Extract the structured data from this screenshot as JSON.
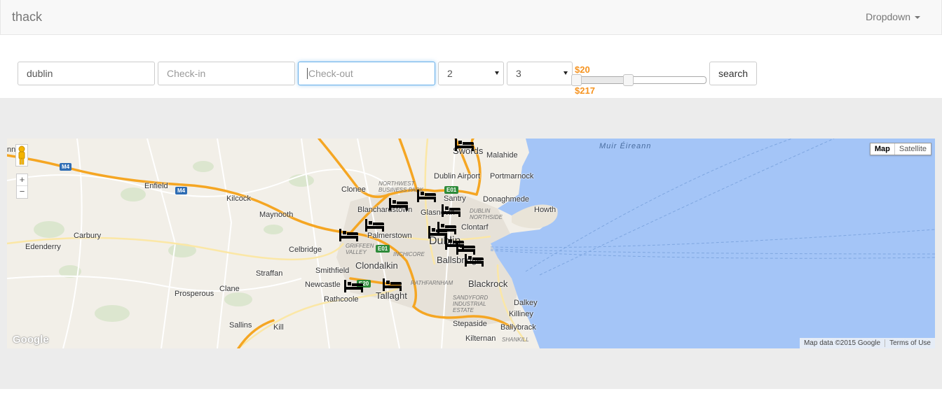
{
  "navbar": {
    "brand": "thack",
    "dropdown_label": "Dropdown"
  },
  "search": {
    "destination_value": "dublin",
    "checkin_placeholder": "Check-in",
    "checkout_placeholder": "Check-out",
    "guests_selected": "2",
    "rooms_selected": "3",
    "price_range_label": "$20 - $217",
    "price_range": {
      "min": 20,
      "max": 217,
      "low_fraction": 0.0,
      "high_fraction": 0.42
    },
    "search_button": "search"
  },
  "map": {
    "map_type_buttons": [
      "Map",
      "Satellite"
    ],
    "active_map_type": "Map",
    "zoom_in": "+",
    "zoom_out": "−",
    "google_logo": "Google",
    "attribution": "Map data ©2015 Google",
    "terms": "Terms of Use",
    "sea_label": "Muir Éireann",
    "places": {
      "swords": "Swords",
      "malahide": "Malahide",
      "dublin_airport": "Dublin Airport",
      "portmarnock": "Portmarnock",
      "clonee": "Clonee",
      "santry": "Santry",
      "donaghmede": "Donaghmede",
      "howth": "Howth",
      "blanchardstown": "Blanchardstown",
      "glasnevin": "Glasnevin",
      "clontarf": "Clontarf",
      "dublin": "Dublin",
      "ballsbridge": "Ballsbridge",
      "palmerstown": "Palmerstown",
      "enfield": "Enfield",
      "kilcock": "Kilcock",
      "maynooth": "Maynooth",
      "leixlip": "nnnd",
      "carbury": "Carbury",
      "edenderry": "Edenderry",
      "celbridge": "Celbridge",
      "clondalkin": "Clondalkin",
      "straffan": "Straffan",
      "smithfield": "Smithfield",
      "newcastle": "Newcastle",
      "clane": "Clane",
      "prosperous": "Prosperous",
      "rathcoole": "Rathcoole",
      "tallaght": "Tallaght",
      "blackrock": "Blackrock",
      "dalkey": "Dalkey",
      "killiney": "Killiney",
      "stepaside": "Stepaside",
      "ballybrack": "Ballybrack",
      "sallins": "Sallins",
      "kill": "Kill",
      "kilternan": "Kilternan"
    },
    "areas": {
      "northwest_business_park": "NORTHWEST BUSINESS PARK",
      "dublin_northside": "DUBLIN NORTHSIDE",
      "griffeen_valley": "GRIFFEEN VALLEY",
      "inchicore": "INCHICORE",
      "rathfarnham": "RATHFARNHAM",
      "sandyford": "SANDYFORD INDUSTRIAL ESTATE",
      "shankill": "SHANKILL"
    },
    "road_shields": [
      "M4",
      "M4",
      "E01",
      "E01",
      "E20"
    ],
    "hotel_marker_icon": "bed-icon"
  },
  "colors": {
    "accent_orange": "#f6931f",
    "sea": "#a4c5f7",
    "land": "#f2efe8",
    "motorway": "#f5a623"
  }
}
